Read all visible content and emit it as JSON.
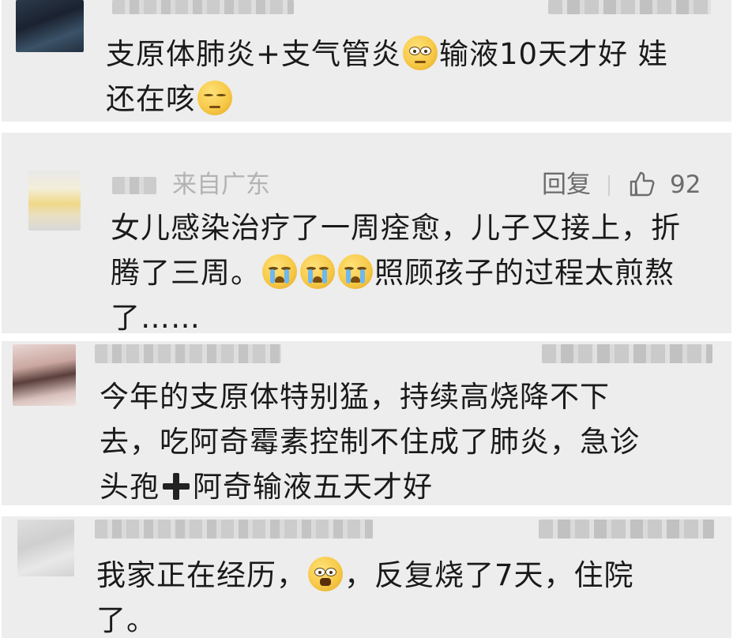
{
  "comments": [
    {
      "text_line1": "支原体肺炎+支气管炎",
      "text_line1b": "输液10天才好 娃",
      "text_line2": "还在咳"
    },
    {
      "location": "来自广东",
      "reply_label": "回复",
      "like_count": "92",
      "text_line1": "女儿感染治疗了一周痊愈，儿子又接上，折",
      "text_line2a": "腾了三周。",
      "text_line2b": "照顾孩子的过程太煎熬",
      "text_line3": "了……"
    },
    {
      "text_line1": "今年的支原体特别猛，持续高烧降不下",
      "text_line2": "去，吃阿奇霉素控制不住成了肺炎，急诊",
      "text_line3a": "头孢",
      "text_line3b": "阿奇输液五天才好"
    },
    {
      "text_line1a": "我家正在经历，",
      "text_line1b": "，反复烧了7天，住院",
      "text_line2": "了。"
    }
  ],
  "icons": {
    "emoji_roll_eyes": "rolling-eyes-emoji",
    "emoji_expressionless": "expressionless-emoji",
    "emoji_cry": "crying-emoji",
    "emoji_sob": "loudly-crying-emoji",
    "plus": "heavy-plus-icon",
    "like": "thumbs-up-icon"
  },
  "colors": {
    "card_bg": "#ededed",
    "text": "#1a1a1a",
    "meta_text": "#b3b3b3",
    "action_text": "#6c6c6c"
  }
}
